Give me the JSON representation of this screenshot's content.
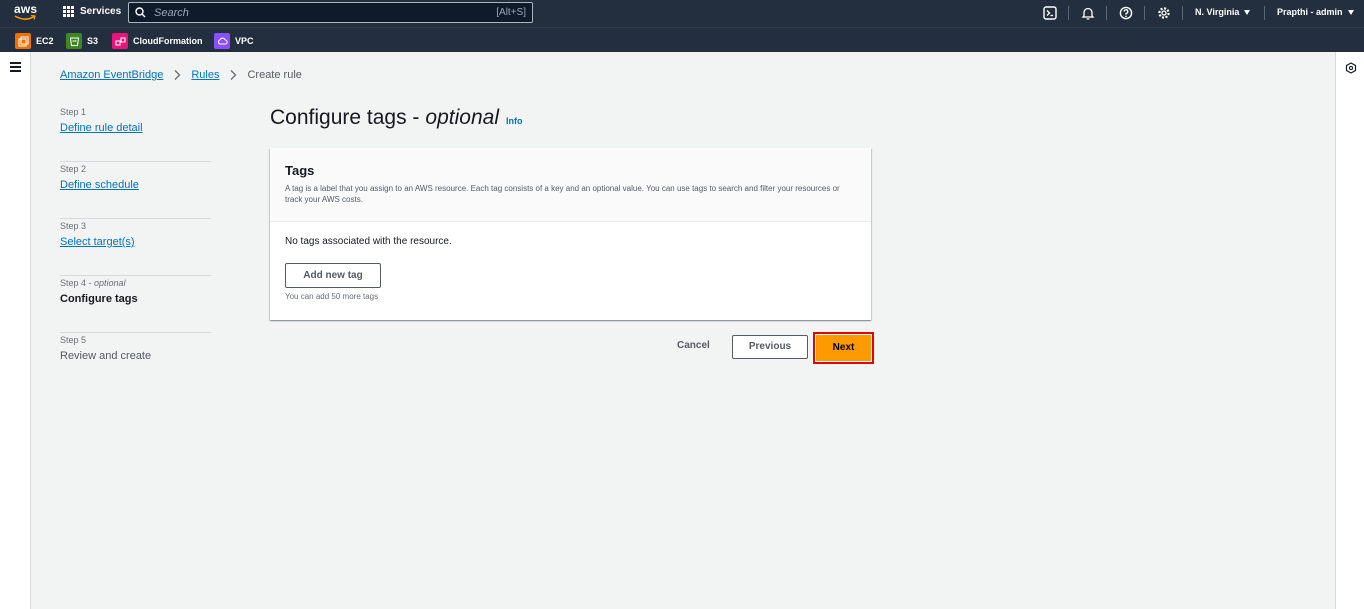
{
  "topnav": {
    "logo_text": "aws",
    "services_label": "Services",
    "search_placeholder": "Search",
    "search_shortcut": "[Alt+S]",
    "icons": [
      "cloudshell-icon",
      "bell-icon",
      "help-icon",
      "gear-icon"
    ],
    "region": "N. Virginia",
    "user": "Prapthi - admin"
  },
  "favorites": [
    {
      "label": "EC2",
      "color": "#ed7100"
    },
    {
      "label": "S3",
      "color": "#3f8624"
    },
    {
      "label": "CloudFormation",
      "color": "#e7157b"
    },
    {
      "label": "VPC",
      "color": "#8c4fff"
    }
  ],
  "breadcrumb": {
    "items": [
      "Amazon EventBridge",
      "Rules"
    ],
    "current": "Create rule"
  },
  "steps": [
    {
      "num": "Step 1",
      "label": "Define rule detail"
    },
    {
      "num": "Step 2",
      "label": "Define schedule"
    },
    {
      "num": "Step 3",
      "label": "Select target(s)"
    },
    {
      "num": "Step 4",
      "optional": "optional",
      "label": "Configure tags"
    },
    {
      "num": "Step 5",
      "label": "Review and create"
    }
  ],
  "page": {
    "title": "Configure tags -",
    "title_optional": "optional",
    "info": "Info"
  },
  "panel": {
    "title": "Tags",
    "description": "A tag is a label that you assign to an AWS resource. Each tag consists of a key and an optional value. You can use tags to search and filter your resources or track your AWS costs.",
    "empty_text": "No tags associated with the resource.",
    "add_button": "Add new tag",
    "hint": "You can add 50 more tags"
  },
  "actions": {
    "cancel": "Cancel",
    "previous": "Previous",
    "next": "Next"
  },
  "colors": {
    "nav_bg": "#232f3e",
    "link": "#0073bb",
    "primary": "#ff9900",
    "highlight": "#e3000f"
  }
}
